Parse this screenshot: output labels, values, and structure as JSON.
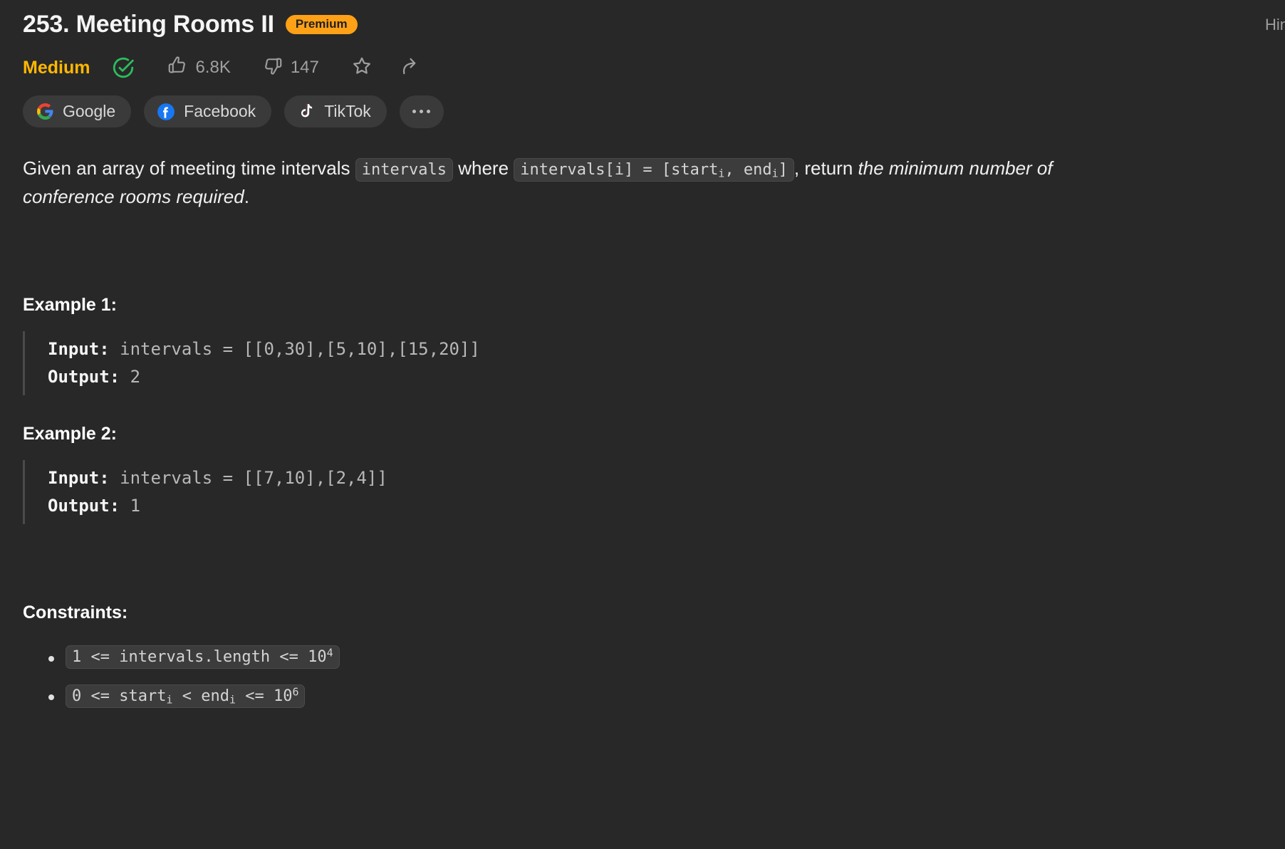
{
  "header": {
    "title": "253. Meeting Rooms II",
    "premium_label": "Premium",
    "hints_label": "Hints"
  },
  "stats": {
    "difficulty": "Medium",
    "solved_icon": "check-circle-icon",
    "likes_icon": "thumbs-up-icon",
    "likes": "6.8K",
    "dislikes_icon": "thumbs-down-icon",
    "dislikes": "147",
    "favorite_icon": "star-icon",
    "share_icon": "share-icon",
    "accent_color": "#ffb800",
    "solved_color": "#2cbb5d"
  },
  "companies": [
    {
      "name": "Google",
      "icon": "google-logo-icon"
    },
    {
      "name": "Facebook",
      "icon": "facebook-logo-icon"
    },
    {
      "name": "TikTok",
      "icon": "tiktok-logo-icon"
    }
  ],
  "companies_more_icon": "ellipsis-icon",
  "description": {
    "part1": "Given an array of meeting time intervals ",
    "code1": "intervals",
    "part2": " where ",
    "code2_prefix": "intervals[i] = [start",
    "code2_sub1": "i",
    "code2_mid": ", end",
    "code2_sub2": "i",
    "code2_suffix": "]",
    "part3": ", return ",
    "italic": "the minimum number of conference rooms required",
    "part4": "."
  },
  "examples": [
    {
      "title": "Example 1:",
      "input_label": "Input:",
      "input_value": " intervals = [[0,30],[5,10],[15,20]]",
      "output_label": "Output:",
      "output_value": " 2"
    },
    {
      "title": "Example 2:",
      "input_label": "Input:",
      "input_value": " intervals = [[7,10],[2,4]]",
      "output_label": "Output:",
      "output_value": " 1"
    }
  ],
  "constraints": {
    "title": "Constraints:",
    "items": [
      {
        "prefix": "1 <= intervals.length <= 10",
        "sup": "4",
        "suffix": ""
      },
      {
        "prefix": "0 <= start",
        "sub1": "i",
        "mid": " < end",
        "sub2": "i",
        "tail": " <= 10",
        "sup": "6"
      }
    ]
  }
}
